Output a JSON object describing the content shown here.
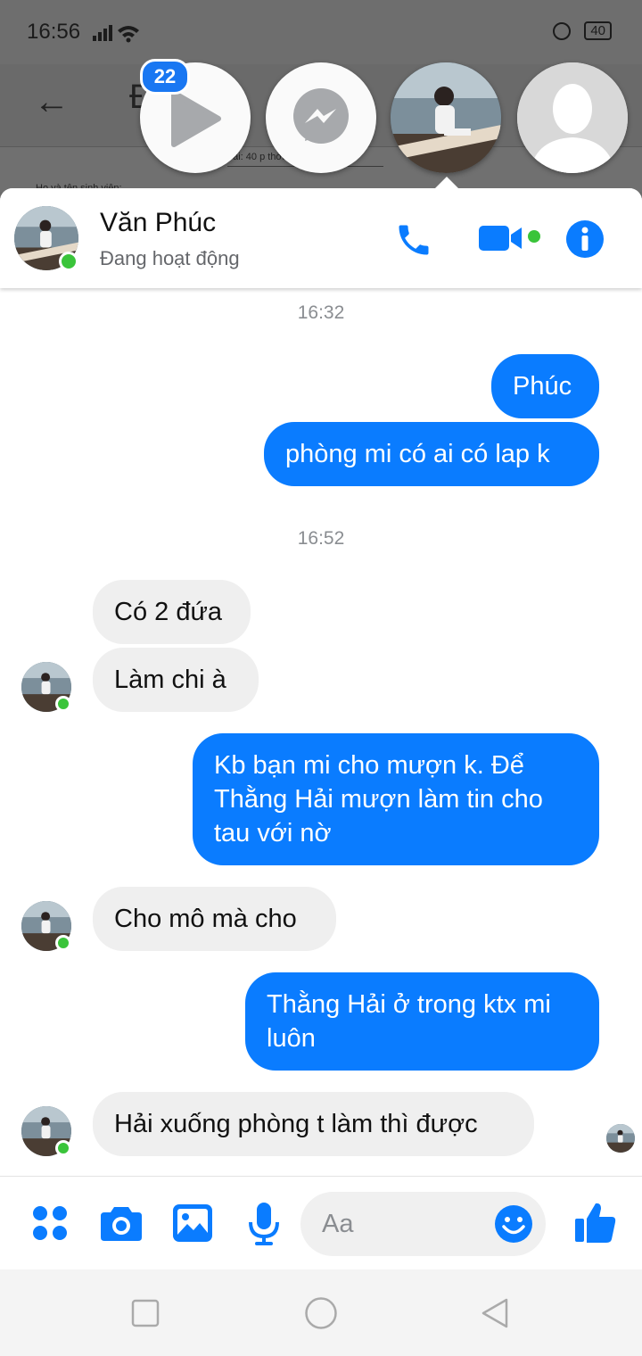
{
  "status_bar": {
    "time": "16:56",
    "battery": "40"
  },
  "background_app": {
    "title_partial": "Đ          Th",
    "paper_line": "bài: 40 p          thời gian",
    "paper_small": "Họ và tên sinh viên:"
  },
  "chat_heads": {
    "badge_count": "22",
    "items": [
      "video-play",
      "messenger",
      "Văn Phúc",
      "unknown-contact"
    ]
  },
  "header": {
    "contact_name": "Văn Phúc",
    "status": "Đang hoạt động"
  },
  "messages": {
    "time1": "16:32",
    "m1": "Phúc",
    "m2": "phòng mi có ai có lap k",
    "time2": "16:52",
    "m3": "Có 2 đứa",
    "m4": "Làm chi à",
    "m5a": "Kb bạn mi cho mượn k. Để",
    "m5b": "Thằng Hải mượn làm tin cho",
    "m5c": "tau với nờ",
    "m6": "Cho mô mà cho",
    "m7a": "Thằng Hải ở trong ktx mi",
    "m7b": "luôn",
    "m8": "Hải xuống phòng t làm thì được"
  },
  "composer": {
    "placeholder": "Aa"
  },
  "icons": {
    "header": [
      "phone-icon",
      "video-camera-icon",
      "info-icon"
    ],
    "composer": [
      "apps-icon",
      "camera-icon",
      "gallery-icon",
      "microphone-icon",
      "emoji-icon",
      "like-icon"
    ],
    "navbar": [
      "recent-apps-icon",
      "home-icon",
      "back-icon"
    ]
  },
  "colors": {
    "accent": "#0a7cff",
    "online": "#3ac43a",
    "incoming_bubble": "#efefef"
  }
}
